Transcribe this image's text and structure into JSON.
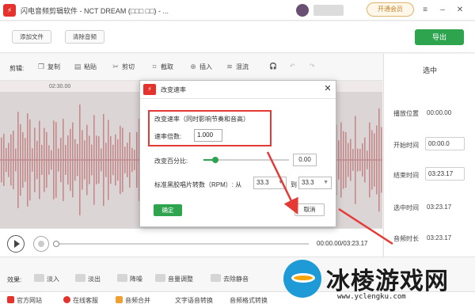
{
  "app": {
    "title": "闪电音频剪辑软件 - NCT DREAM (□□□ □□) - ...",
    "icon": "lightning-app-icon",
    "vip_label": "开通会员"
  },
  "toolbar": {
    "add_file": "添加文件",
    "clear_audio": "清除音频",
    "export": "导出"
  },
  "editbar": {
    "label": "剪辑:",
    "items": [
      {
        "label": "复制",
        "icon": "copy-icon"
      },
      {
        "label": "粘贴",
        "icon": "paste-icon"
      },
      {
        "label": "剪切",
        "icon": "scissors-icon"
      },
      {
        "label": "截取",
        "icon": "crop-icon"
      },
      {
        "label": "插入",
        "icon": "insert-icon"
      },
      {
        "label": "混流",
        "icon": "mix-icon"
      }
    ]
  },
  "ruler": {
    "mark": "02:30.00"
  },
  "right_panel": {
    "title": "选中",
    "rows": [
      {
        "label": "播放位置",
        "value": "00:00.00"
      },
      {
        "label": "开始时间",
        "value": "00:00.0"
      },
      {
        "label": "结束时间",
        "value": "03:23.17"
      },
      {
        "label": "选中时间",
        "value": "03:23.17"
      },
      {
        "label": "音频时长",
        "value": "03:23.17"
      }
    ]
  },
  "transport": {
    "time": "00:00.00/03:23.17",
    "progress": 0
  },
  "effects": {
    "label": "效果:",
    "items": [
      "淡入",
      "淡出",
      "降噪",
      "音量调整",
      "去除静音"
    ]
  },
  "footer": {
    "items": [
      "官方网站",
      "在线客服",
      "音频合并",
      "文字语音转换",
      "音频格式转换"
    ]
  },
  "dialog": {
    "title": "改变速率",
    "section_title": "改变速率（同时影响节奏和音高）",
    "rate_label": "速率倍数:",
    "rate_value": "1.000",
    "percent_label": "改变百分比:",
    "percent_value": "0.00",
    "rpm_label": "标准黑胶唱片转数（RPM）: 从",
    "rpm_from": "33.3",
    "rpm_to_label": "到",
    "rpm_to": "33.3",
    "ok": "确定",
    "cancel": "取消"
  },
  "watermark": {
    "text": "冰棱游戏网",
    "url": "www.yclengku.com"
  },
  "colors": {
    "accent_green": "#2ea44f",
    "brand_red": "#e5322d",
    "highlight_red": "#e53935",
    "waveform": "#c48a8c"
  }
}
